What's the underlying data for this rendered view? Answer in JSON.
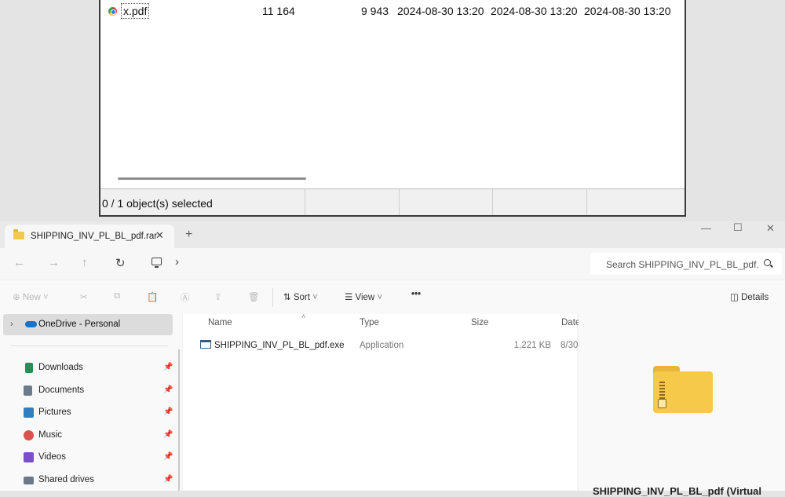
{
  "archive_window": {
    "row": {
      "name": "x.pdf",
      "size": "11 164",
      "packed_size": "9 943",
      "modified": "2024-08-30 13:20",
      "created": "2024-08-30 13:20",
      "accessed": "2024-08-30 13:20"
    },
    "status": "0 / 1 object(s) selected"
  },
  "explorer": {
    "tab_title": "SHIPPING_INV_PL_BL_pdf.rar",
    "tab_close": "✕",
    "new_tab": "+",
    "window_controls": {
      "minimize": "—",
      "maximize": "☐",
      "close": "✕"
    },
    "nav": {
      "back": "←",
      "forward": "→",
      "up": "↑",
      "refresh": "↻",
      "breadcrumb_chevron": "›"
    },
    "search_placeholder": "Search SHIPPING_INV_PL_BL_pdf.",
    "commands": {
      "new": "New",
      "sort": "Sort",
      "view": "View",
      "more": "•••",
      "details": "Details"
    },
    "sidebar": {
      "onedrive": "OneDrive - Personal",
      "items": [
        {
          "label": "Downloads",
          "icon": "download-icon",
          "color": "#2e8b57"
        },
        {
          "label": "Documents",
          "icon": "document-icon",
          "color": "#6a7b8c"
        },
        {
          "label": "Pictures",
          "icon": "pictures-icon",
          "color": "#2f7fc1"
        },
        {
          "label": "Music",
          "icon": "music-icon",
          "color": "#d9534f"
        },
        {
          "label": "Videos",
          "icon": "video-icon",
          "color": "#7b4fc9"
        },
        {
          "label": "Shared drives",
          "icon": "drive-icon",
          "color": "#6b7a8a"
        }
      ],
      "pin_glyph": "📌"
    },
    "columns": {
      "name": "Name",
      "type": "Type",
      "size": "Size",
      "date": "Date"
    },
    "files": [
      {
        "name": "SHIPPING_INV_PL_BL_pdf.exe",
        "type": "Application",
        "size": "1,221 KB",
        "date": "8/30"
      }
    ],
    "details_title": "SHIPPING_INV_PL_BL_pdf (Virtual"
  }
}
